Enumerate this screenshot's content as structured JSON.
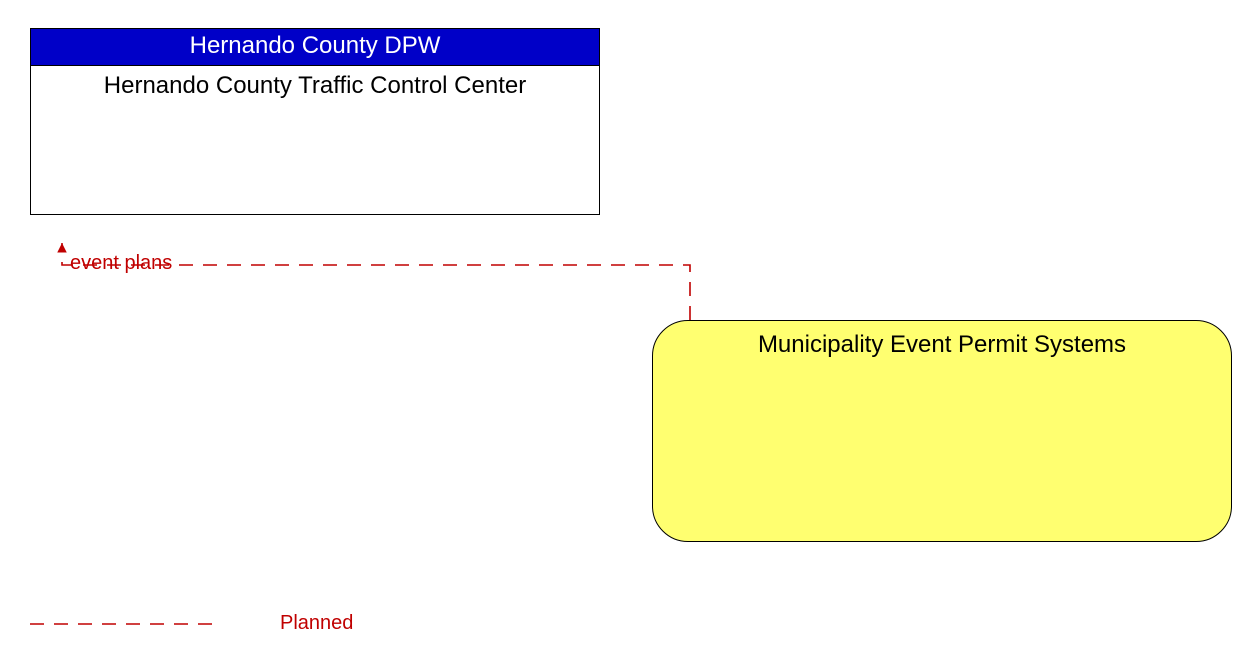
{
  "nodes": {
    "top": {
      "header": "Hernando County DPW",
      "title": "Hernando County Traffic Control Center"
    },
    "yellow": {
      "title": "Municipality Event Permit Systems"
    }
  },
  "flows": {
    "event_plans": "event plans"
  },
  "legend": {
    "planned": "Planned"
  },
  "colors": {
    "header_bg": "#0000c8",
    "flow": "#c00000",
    "yellow_bg": "#ffff70"
  }
}
